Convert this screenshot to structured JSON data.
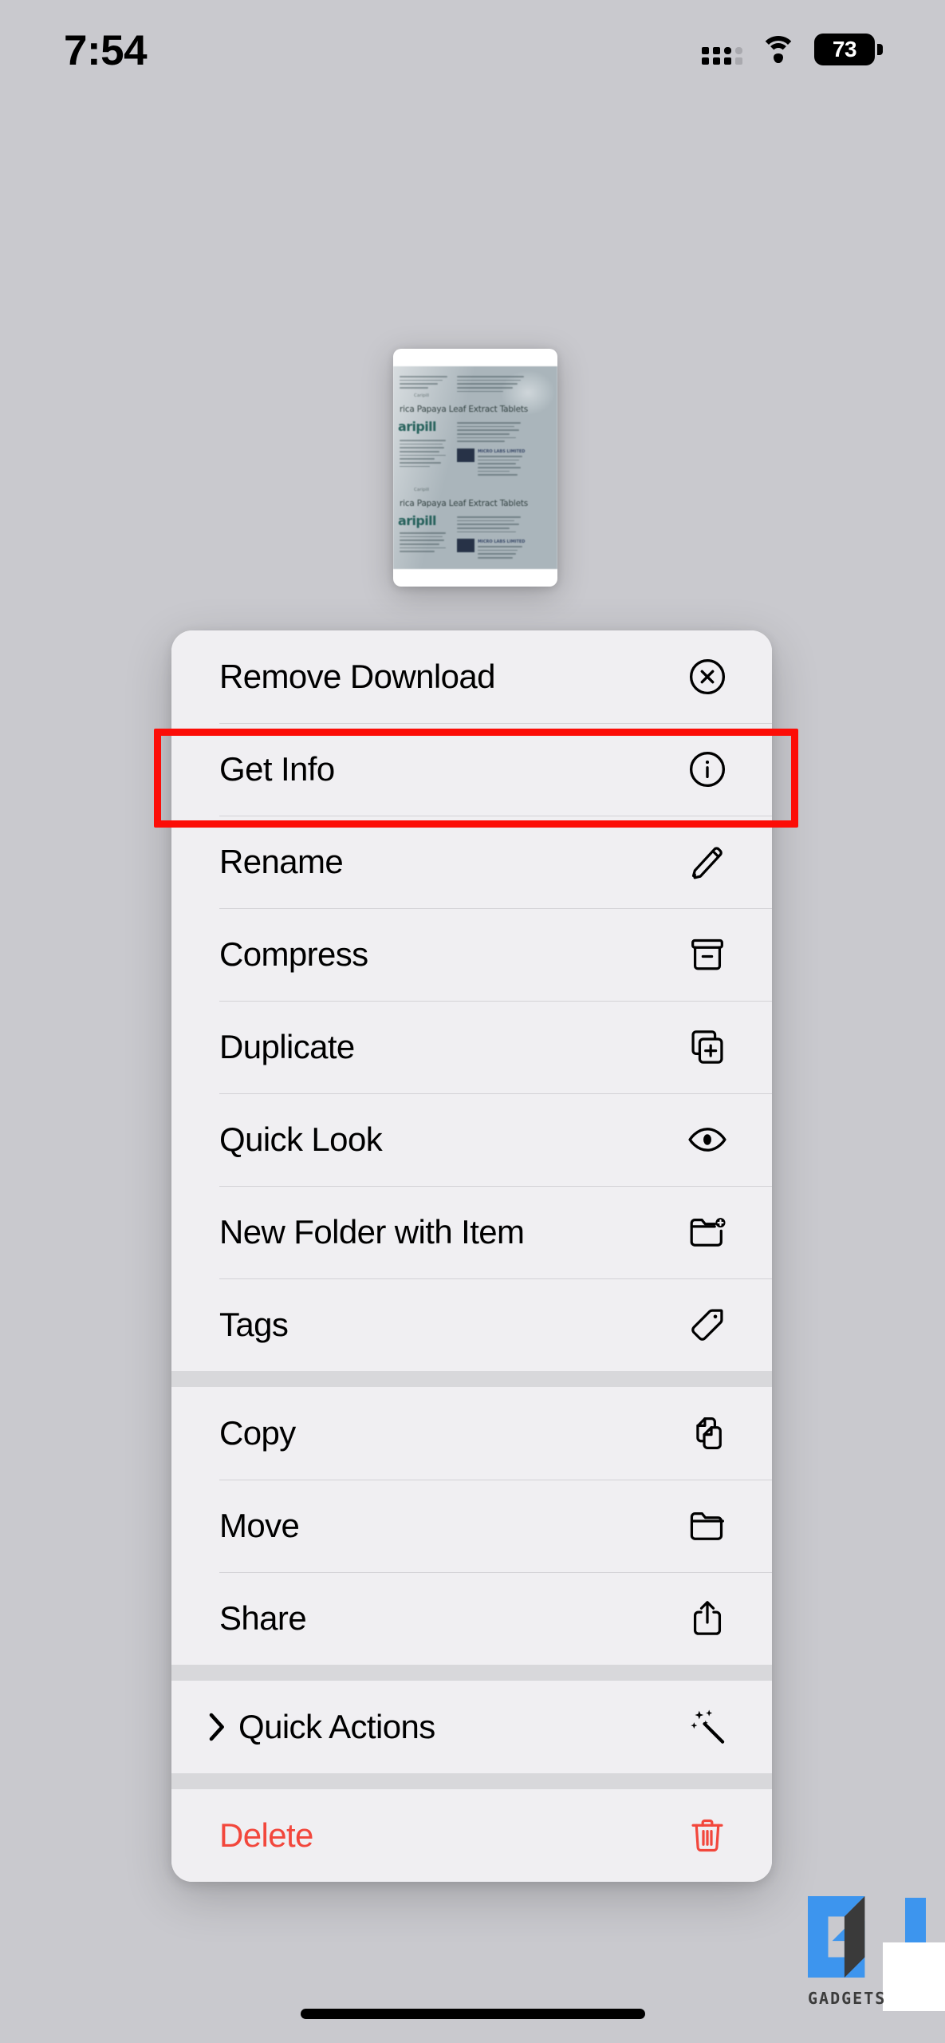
{
  "status_bar": {
    "time": "7:54",
    "battery_percent": "73",
    "cellular_icon": "cellular-bars-icon",
    "wifi_icon": "wifi-icon",
    "battery_icon": "battery-icon"
  },
  "preview": {
    "icon": "file-preview-thumbnail",
    "image_subject": "Caripill Carica Papaya Leaf Extract Tablets blister pack photo",
    "package_title": "rica Papaya Leaf Extract Tablets",
    "package_title_2": "rica Papaya Leaf Extract Tablets",
    "package_brand": "aripill",
    "package_brand_2": "aripill",
    "package_manufacturer": "MICRO LABS LIMITED",
    "package_manufacturer_2": "MICRO LABS LIMITED"
  },
  "context_menu": {
    "groups": [
      {
        "items": [
          {
            "label": "Remove Download",
            "icon": "xmark-circle-icon",
            "destructive": false,
            "submenu": false
          },
          {
            "label": "Get Info",
            "icon": "info-circle-icon",
            "destructive": false,
            "submenu": false
          },
          {
            "label": "Rename",
            "icon": "pencil-icon",
            "destructive": false,
            "submenu": false
          },
          {
            "label": "Compress",
            "icon": "archivebox-icon",
            "destructive": false,
            "submenu": false
          },
          {
            "label": "Duplicate",
            "icon": "plus-square-on-square-icon",
            "destructive": false,
            "submenu": false
          },
          {
            "label": "Quick Look",
            "icon": "eye-icon",
            "destructive": false,
            "submenu": false
          },
          {
            "label": "New Folder with Item",
            "icon": "folder-badge-plus-icon",
            "destructive": false,
            "submenu": false
          },
          {
            "label": "Tags",
            "icon": "tag-icon",
            "destructive": false,
            "submenu": false
          }
        ]
      },
      {
        "items": [
          {
            "label": "Copy",
            "icon": "doc-on-doc-icon",
            "destructive": false,
            "submenu": false
          },
          {
            "label": "Move",
            "icon": "folder-icon",
            "destructive": false,
            "submenu": false
          },
          {
            "label": "Share",
            "icon": "share-square-arrow-up-icon",
            "destructive": false,
            "submenu": false
          }
        ]
      },
      {
        "items": [
          {
            "label": "Quick Actions",
            "icon": "wand-sparkles-icon",
            "destructive": false,
            "submenu": true,
            "submenu_icon": "chevron-right-icon"
          }
        ]
      },
      {
        "items": [
          {
            "label": "Delete",
            "icon": "trash-icon",
            "destructive": true,
            "submenu": false
          }
        ]
      }
    ]
  },
  "annotation": {
    "highlight_target": "Get Info",
    "highlight_color": "#fc0d07"
  },
  "watermark": {
    "text": "GADGETS",
    "logo": "gt-logo",
    "accent_color": "#3d95ee"
  },
  "home_indicator": {
    "icon": "home-indicator-bar"
  },
  "theme": {
    "background": "#c9c9ce",
    "menu_surface": "#f0eff2",
    "separator": "#d3d2d6",
    "group_gap": "#d8d8db",
    "destructive": "#f2473c"
  }
}
